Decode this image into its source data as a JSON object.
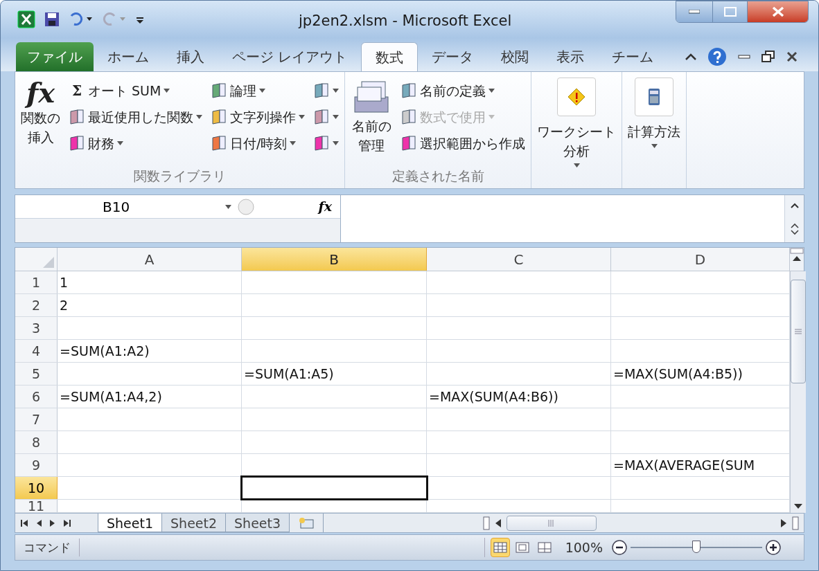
{
  "window": {
    "title": "jp2en2.xlsm - Microsoft Excel"
  },
  "ribbon_tabs": [
    {
      "label": "ファイル",
      "kind": "file",
      "selected": false
    },
    {
      "label": "ホーム",
      "kind": "tab",
      "selected": false
    },
    {
      "label": "挿入",
      "kind": "tab",
      "selected": false
    },
    {
      "label": "ページ レイアウト",
      "kind": "tab",
      "selected": false
    },
    {
      "label": "数式",
      "kind": "tab",
      "selected": true
    },
    {
      "label": "データ",
      "kind": "tab",
      "selected": false
    },
    {
      "label": "校閲",
      "kind": "tab",
      "selected": false
    },
    {
      "label": "表示",
      "kind": "tab",
      "selected": false
    },
    {
      "label": "チーム",
      "kind": "tab",
      "selected": false
    }
  ],
  "ribbon_groups": [
    {
      "label": "関数ライブラリ",
      "big_buttons": [
        {
          "symbol": "fx",
          "lines": [
            "関数の",
            "挿入"
          ],
          "dropdown": false
        }
      ],
      "columns": [
        [
          {
            "symbol": "Σ",
            "label": "オート SUM",
            "dropdown": true,
            "disabled": false
          },
          {
            "label": "最近使用した関数",
            "dropdown": true,
            "disabled": false
          },
          {
            "label": "財務",
            "dropdown": true,
            "disabled": false
          }
        ],
        [
          {
            "label": "論理",
            "dropdown": true,
            "disabled": false
          },
          {
            "label": "文字列操作",
            "dropdown": true,
            "disabled": false
          },
          {
            "label": "日付/時刻",
            "dropdown": true,
            "disabled": false
          }
        ],
        [
          {
            "dropdown": true,
            "disabled": false
          },
          {
            "dropdown": true,
            "disabled": false
          },
          {
            "dropdown": true,
            "disabled": false
          }
        ]
      ]
    },
    {
      "label": "定義された名前",
      "big_buttons": [
        {
          "lines": [
            "名前の",
            "管理"
          ],
          "dropdown": false
        }
      ],
      "columns": [
        [
          {
            "label": "名前の定義",
            "dropdown": true,
            "disabled": false
          },
          {
            "label": "数式で使用",
            "dropdown": true,
            "disabled": true
          },
          {
            "label": "選択範囲から作成",
            "dropdown": false,
            "disabled": false
          }
        ]
      ]
    },
    {
      "big_buttons": [
        {
          "lines": [
            "ワークシート",
            "分析"
          ],
          "dropdown": true
        }
      ]
    },
    {
      "big_buttons": [
        {
          "lines": [
            "計算方法"
          ],
          "dropdown": true
        }
      ]
    }
  ],
  "formula_bar": {
    "name_box": "B10",
    "function_symbol": "fx"
  },
  "columns": [
    {
      "label": "A",
      "selected": false
    },
    {
      "label": "B",
      "selected": true
    },
    {
      "label": "C",
      "selected": false
    },
    {
      "label": "D",
      "selected": false
    }
  ],
  "rows": [
    {
      "header": "1",
      "selected": false,
      "cells": [
        "1",
        "",
        "",
        ""
      ]
    },
    {
      "header": "2",
      "selected": false,
      "cells": [
        "2",
        "",
        "",
        ""
      ]
    },
    {
      "header": "3",
      "selected": false,
      "cells": [
        "",
        "",
        "",
        ""
      ]
    },
    {
      "header": "4",
      "selected": false,
      "cells": [
        "=SUM(A1:A2)",
        "",
        "",
        ""
      ]
    },
    {
      "header": "5",
      "selected": false,
      "cells": [
        "",
        "=SUM(A1:A5)",
        "",
        "=MAX(SUM(A4:B5))"
      ]
    },
    {
      "header": "6",
      "selected": false,
      "cells": [
        "=SUM(A1:A4,2)",
        "",
        "=MAX(SUM(A4:B6))",
        ""
      ]
    },
    {
      "header": "7",
      "selected": false,
      "cells": [
        "",
        "",
        "",
        ""
      ]
    },
    {
      "header": "8",
      "selected": false,
      "cells": [
        "",
        "",
        "",
        ""
      ]
    },
    {
      "header": "9",
      "selected": false,
      "cells": [
        "",
        "",
        "",
        "=MAX(AVERAGE(SUM"
      ]
    },
    {
      "header": "10",
      "selected": true,
      "cells": [
        "",
        "",
        "",
        ""
      ]
    },
    {
      "header": "11",
      "selected": false,
      "cells": [
        "",
        "",
        "",
        ""
      ]
    }
  ],
  "sheet_tabs": [
    {
      "label": "Sheet1",
      "selected": true
    },
    {
      "label": "Sheet2",
      "selected": false
    },
    {
      "label": "Sheet3",
      "selected": false
    }
  ],
  "status_bar": {
    "mode": "コマンド",
    "views": [
      {
        "selected": true
      },
      {
        "selected": false
      },
      {
        "selected": false
      }
    ],
    "zoom": "100%",
    "zoom_slider": {
      "level": 0.5
    }
  }
}
